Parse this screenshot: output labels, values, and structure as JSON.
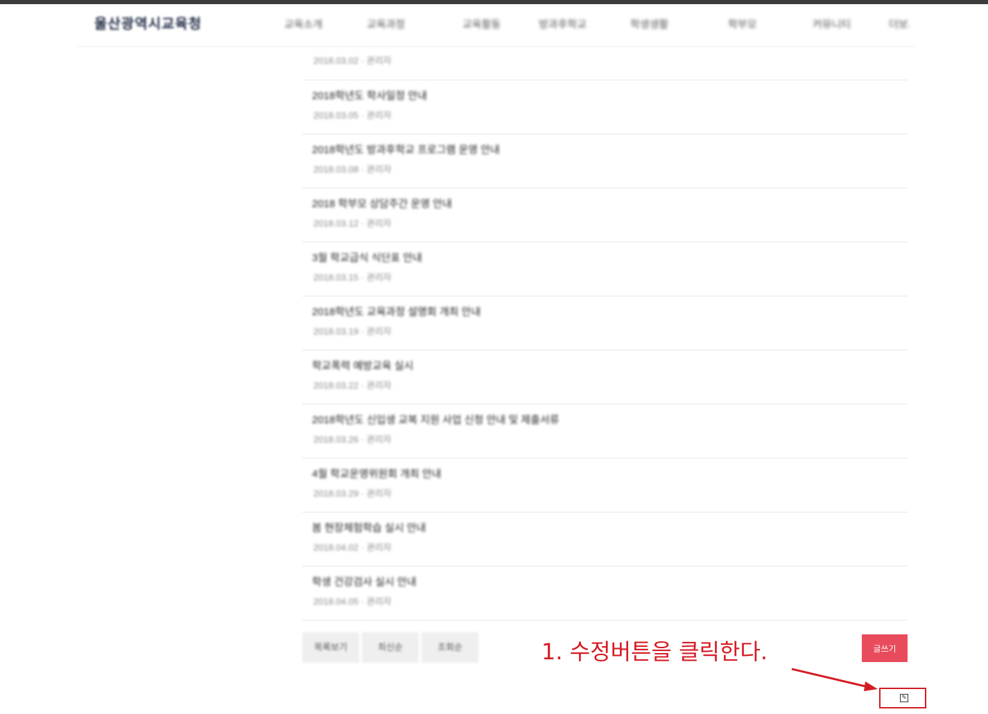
{
  "header": {
    "logo": "울산광역시교육청",
    "nav": [
      "교육소개",
      "교육과정",
      "교육활동",
      "방과후학교",
      "학생생활",
      "학부모",
      "커뮤니티",
      "더보기"
    ]
  },
  "list": {
    "first_meta": "2018.03.02 · 관리자",
    "rows": [
      {
        "title": "2018학년도 학사일정 안내",
        "meta": "2018.03.05 · 관리자"
      },
      {
        "title": "2018학년도 방과후학교 프로그램 운영 안내",
        "meta": "2018.03.08 · 관리자"
      },
      {
        "title": "2018 학부모 상담주간 운영 안내",
        "meta": "2018.03.12 · 관리자"
      },
      {
        "title": "3월 학교급식 식단표 안내",
        "meta": "2018.03.15 · 관리자"
      },
      {
        "title": "2018학년도 교육과정 설명회 개최 안내",
        "meta": "2018.03.19 · 관리자"
      },
      {
        "title": "학교폭력 예방교육 실시",
        "meta": "2018.03.22 · 관리자"
      },
      {
        "title": "2018학년도 신입생 교복 지원 사업 신청 안내 및 제출서류",
        "meta": "2018.03.26 · 관리자"
      },
      {
        "title": "4월 학교운영위원회 개최 안내",
        "meta": "2018.03.29 · 관리자"
      },
      {
        "title": "봄 현장체험학습 실시 안내",
        "meta": "2018.04.02 · 관리자"
      },
      {
        "title": "학생 건강검사 실시 안내",
        "meta": "2018.04.05 · 관리자"
      }
    ]
  },
  "buttons": {
    "group": [
      "목록보기",
      "최신순",
      "조회순"
    ],
    "write": "글쓰기"
  },
  "annotation": {
    "text": "1. 수정버튼을 클릭한다.",
    "color": "#d41c24"
  },
  "colors": {
    "accent": "#e84c5c",
    "annotation_red": "#d41c24"
  },
  "icons": {
    "edit": "edit-icon"
  }
}
